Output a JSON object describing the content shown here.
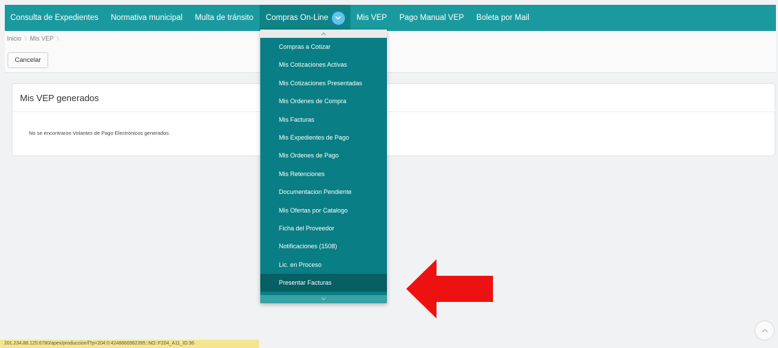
{
  "nav": {
    "items": [
      "Consulta de Expedientes",
      "Normativa municipal",
      "Multa de tránsito",
      "Compras On-Line",
      "Mis VEP",
      "Pago Manual VEP",
      "Boleta por Mail"
    ],
    "active_index": 3,
    "color": "#1a9a9e"
  },
  "breadcrumb": {
    "items": [
      "Inicio",
      "Mis VEP"
    ],
    "separator": "\\"
  },
  "actions": {
    "cancel_label": "Cancelar"
  },
  "card": {
    "title": "Mis VEP generados",
    "message": "No se encontraron Volantes de Pago Electrónicos generados."
  },
  "dropdown": {
    "items": [
      "Compras a Cotizar",
      "Mis Cotizaciones Activas",
      "Mis Cotizaciones Presentadas",
      "Mis Ordenes de Compra",
      "Mis Facturas",
      "Mis Expedientes de Pago",
      "Mis Ordenes de Pago",
      "Mis Retenciones",
      "Documentacion Pendiente",
      "Mis Ofertas por Catalogo",
      "Ficha del Proveedor",
      "Notificaciones (1508)",
      "Lic. en Proceso",
      "Presentar Facturas"
    ],
    "highlighted_index": 13,
    "color": "#097e84"
  },
  "annotation": {
    "arrow_color": "#ee1111",
    "icon": "red-arrow-icon"
  },
  "status_bar": {
    "url": "201.234.88.125:6780/apex/produccion/f?p=204:0:4248866982395::NO::F204_A11_ID:36"
  }
}
